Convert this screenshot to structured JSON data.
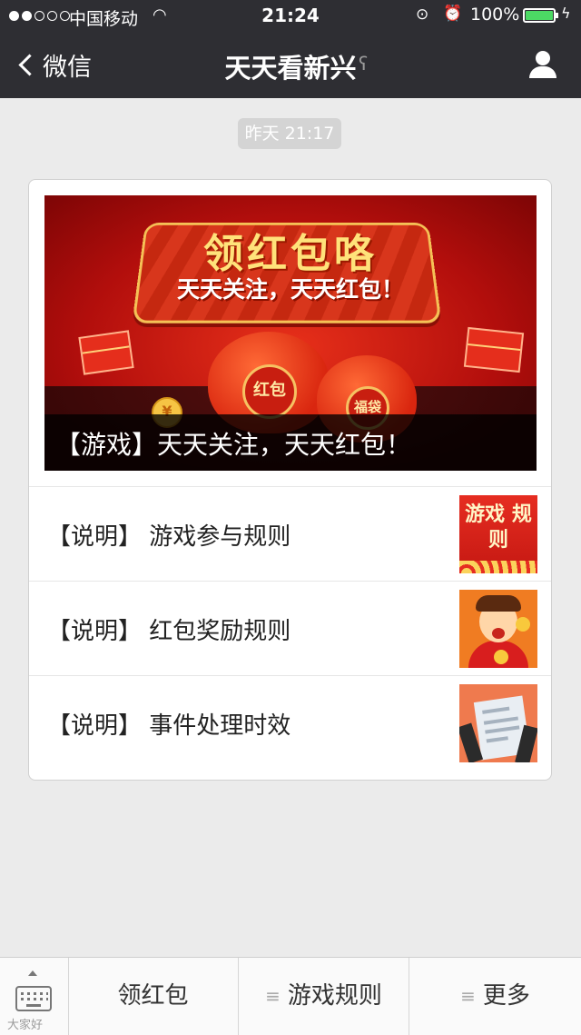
{
  "status_bar": {
    "carrier": "中国移动",
    "time": "21:24",
    "battery": "100%",
    "signal_bars_filled": 2,
    "signal_bars_total": 5
  },
  "nav": {
    "back_label": "微信",
    "title": "天天看新兴"
  },
  "timestamp": "昨天 21:17",
  "article": {
    "banner": {
      "headline": "领红包咯",
      "subheadline": "天天关注，天天红包！",
      "bag_left": "红包",
      "bag_right": "福袋",
      "coin": "¥",
      "caption": "【游戏】天天关注，天天红包！"
    },
    "items": [
      {
        "title": "【说明】 游戏参与规则",
        "thumb_text": "游戏 规则"
      },
      {
        "title": "【说明】 红包奖励规则"
      },
      {
        "title": "【说明】 事件处理时效"
      }
    ]
  },
  "menu": {
    "items": [
      {
        "label": "领红包",
        "has_submenu": false
      },
      {
        "label": "游戏规则",
        "has_submenu": true
      },
      {
        "label": "更多",
        "has_submenu": true
      }
    ]
  },
  "watermark": "大家好",
  "colors": {
    "nav_bg": "#2e2e33",
    "page_bg": "#ebebeb",
    "battery_green": "#4cd964"
  }
}
